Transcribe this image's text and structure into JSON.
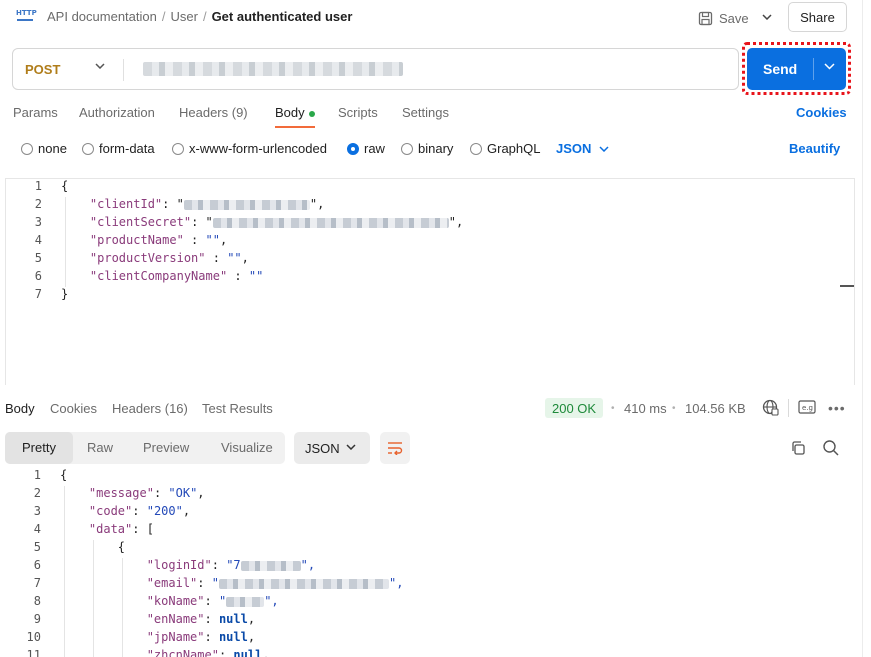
{
  "header": {
    "breadcrumb": [
      "API documentation",
      "User",
      "Get authenticated user"
    ],
    "save_label": "Save",
    "share_label": "Share"
  },
  "request": {
    "method": "POST",
    "send_label": "Send",
    "tabs": [
      "Params",
      "Authorization",
      "Headers (9)",
      "Body",
      "Scripts",
      "Settings"
    ],
    "cookies_label": "Cookies",
    "body_types": [
      "none",
      "form-data",
      "x-www-form-urlencoded",
      "raw",
      "binary",
      "GraphQL"
    ],
    "selected_body_type": "raw",
    "body_format": "JSON",
    "beautify_label": "Beautify",
    "code_lines": [
      {
        "n": "1",
        "prefix": "{",
        "key": "",
        "mid": "",
        "value": "",
        "suffix": ""
      },
      {
        "n": "2",
        "prefix": "    ",
        "key": "\"clientId\"",
        "mid": ": \"",
        "value": "",
        "suffix": "\","
      },
      {
        "n": "3",
        "prefix": "    ",
        "key": "\"clientSecret\"",
        "mid": ": \"",
        "value": "",
        "suffix": "\","
      },
      {
        "n": "4",
        "prefix": "    ",
        "key": "\"productName\"",
        "mid": " : ",
        "value": "\"\"",
        "suffix": ","
      },
      {
        "n": "5",
        "prefix": "    ",
        "key": "\"productVersion\"",
        "mid": " : ",
        "value": "\"\"",
        "suffix": ","
      },
      {
        "n": "6",
        "prefix": "    ",
        "key": "\"clientCompanyName\"",
        "mid": " : ",
        "value": "\"\"",
        "suffix": ""
      },
      {
        "n": "7",
        "prefix": "}",
        "key": "",
        "mid": "",
        "value": "",
        "suffix": ""
      }
    ]
  },
  "response": {
    "tabs": [
      "Body",
      "Cookies",
      "Headers (16)",
      "Test Results"
    ],
    "status": "200 OK",
    "time": "410 ms",
    "size": "104.56 KB",
    "view_modes": [
      "Pretty",
      "Raw",
      "Preview",
      "Visualize"
    ],
    "format": "JSON",
    "code_lines": [
      {
        "n": "1",
        "prefix": "{",
        "key": "",
        "mid": "",
        "value": "",
        "suffix": ""
      },
      {
        "n": "2",
        "prefix": "    ",
        "key": "\"message\"",
        "mid": ": ",
        "value": "\"OK\"",
        "suffix": ","
      },
      {
        "n": "3",
        "prefix": "    ",
        "key": "\"code\"",
        "mid": ": ",
        "value": "\"200\"",
        "suffix": ","
      },
      {
        "n": "4",
        "prefix": "    ",
        "key": "\"data\"",
        "mid": ": [",
        "value": "",
        "suffix": ""
      },
      {
        "n": "5",
        "prefix": "        {",
        "key": "",
        "mid": "",
        "value": "",
        "suffix": ""
      },
      {
        "n": "6",
        "prefix": "            ",
        "key": "\"loginId\"",
        "mid": ": ",
        "value": "\"7",
        "suffix": "\","
      },
      {
        "n": "7",
        "prefix": "            ",
        "key": "\"email\"",
        "mid": ": ",
        "value": "\"",
        "suffix": "\","
      },
      {
        "n": "8",
        "prefix": "            ",
        "key": "\"koName\"",
        "mid": ": ",
        "value": "\"",
        "suffix": "\","
      },
      {
        "n": "9",
        "prefix": "            ",
        "key": "\"enName\"",
        "mid": ": ",
        "value": "null",
        "suffix": ","
      },
      {
        "n": "10",
        "prefix": "            ",
        "key": "\"jpName\"",
        "mid": ": ",
        "value": "null",
        "suffix": ","
      },
      {
        "n": "11",
        "prefix": "            ",
        "key": "\"zhcnName\"",
        "mid": ": ",
        "value": "null",
        "suffix": ","
      }
    ]
  }
}
